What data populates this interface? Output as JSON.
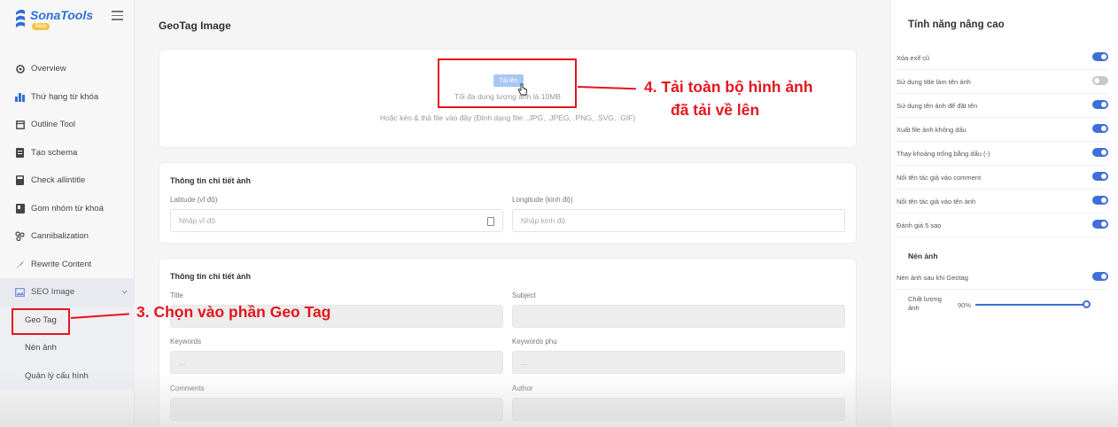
{
  "brand": {
    "name": "SonaTools",
    "badge": "Beta"
  },
  "sidebar": {
    "items": [
      {
        "label": "Overview",
        "icon": "overview-icon"
      },
      {
        "label": "Thứ hạng từ khóa",
        "icon": "ranking-icon"
      },
      {
        "label": "Outline Tool",
        "icon": "outline-icon"
      },
      {
        "label": "Tạo schema",
        "icon": "schema-icon"
      },
      {
        "label": "Check allintitle",
        "icon": "calculator-icon"
      },
      {
        "label": "Gom nhóm từ khoá",
        "icon": "book-icon"
      },
      {
        "label": "Cannibalization",
        "icon": "cluster-icon"
      },
      {
        "label": "Rewrite Content",
        "icon": "feather-icon"
      },
      {
        "label": "SEO Image",
        "icon": "image-icon"
      }
    ],
    "sub_items": [
      {
        "label": "Geo Tag"
      },
      {
        "label": "Nén ảnh"
      },
      {
        "label": "Quản lý cấu hình"
      }
    ]
  },
  "main": {
    "title": "GeoTag Image",
    "upload": {
      "button_label": "Tải lên",
      "max_size": "Tối đa dung lượng ảnh là 10MB",
      "drop_hint": "Hoặc kéo & thả file vào đây (Định dạng file: .JPG, .JPEG, .PNG, .SVG, .GIF)"
    },
    "geo_card": {
      "heading": "Thông tin chi tiết ảnh",
      "latitude_label": "Latitude (vĩ độ)",
      "latitude_placeholder": "Nhập vĩ độ",
      "longitude_label": "Longitude (kinh độ)",
      "longitude_placeholder": "Nhập kinh độ"
    },
    "meta_card": {
      "heading": "Thông tin chi tiết ảnh",
      "title_label": "Title",
      "subject_label": "Subject",
      "keywords_label": "Keywords",
      "keywords_value": "...",
      "keywords_sub_label": "Keywords phụ",
      "keywords_sub_value": "...",
      "comments_label": "Comments",
      "author_label": "Author"
    }
  },
  "right_panel": {
    "title": "Tính năng nâng cao",
    "options": [
      {
        "label": "Xóa exif cũ",
        "on": true
      },
      {
        "label": "Sử dụng title làm tên ảnh",
        "on": false
      },
      {
        "label": "Sử dụng tên ảnh để đặt tên",
        "on": true
      },
      {
        "label": "Xuất file ảnh không dấu",
        "on": true
      },
      {
        "label": "Thay khoảng trống bằng dấu (-)",
        "on": true
      },
      {
        "label": "Nối tên tác giả vào comment",
        "on": true
      },
      {
        "label": "Nối tên tác giả vào tên ảnh",
        "on": true
      },
      {
        "label": "Đánh giá 5 sao",
        "on": true
      }
    ],
    "compress_section": "Nén ảnh",
    "compress_option": {
      "label": "Nén ảnh sau khi Geotag",
      "on": true
    },
    "quality_label": "Chất lượng ảnh",
    "quality_value": "90%",
    "quality_fraction": 0.9
  },
  "annotations": {
    "step3": "3. Chọn vào phần Geo Tag",
    "step4_line1": "4. Tải toàn bộ hình ảnh",
    "step4_line2": "đã tải về lên"
  },
  "colors": {
    "accent": "#3f6fd8",
    "annotation": "#e3161d"
  }
}
